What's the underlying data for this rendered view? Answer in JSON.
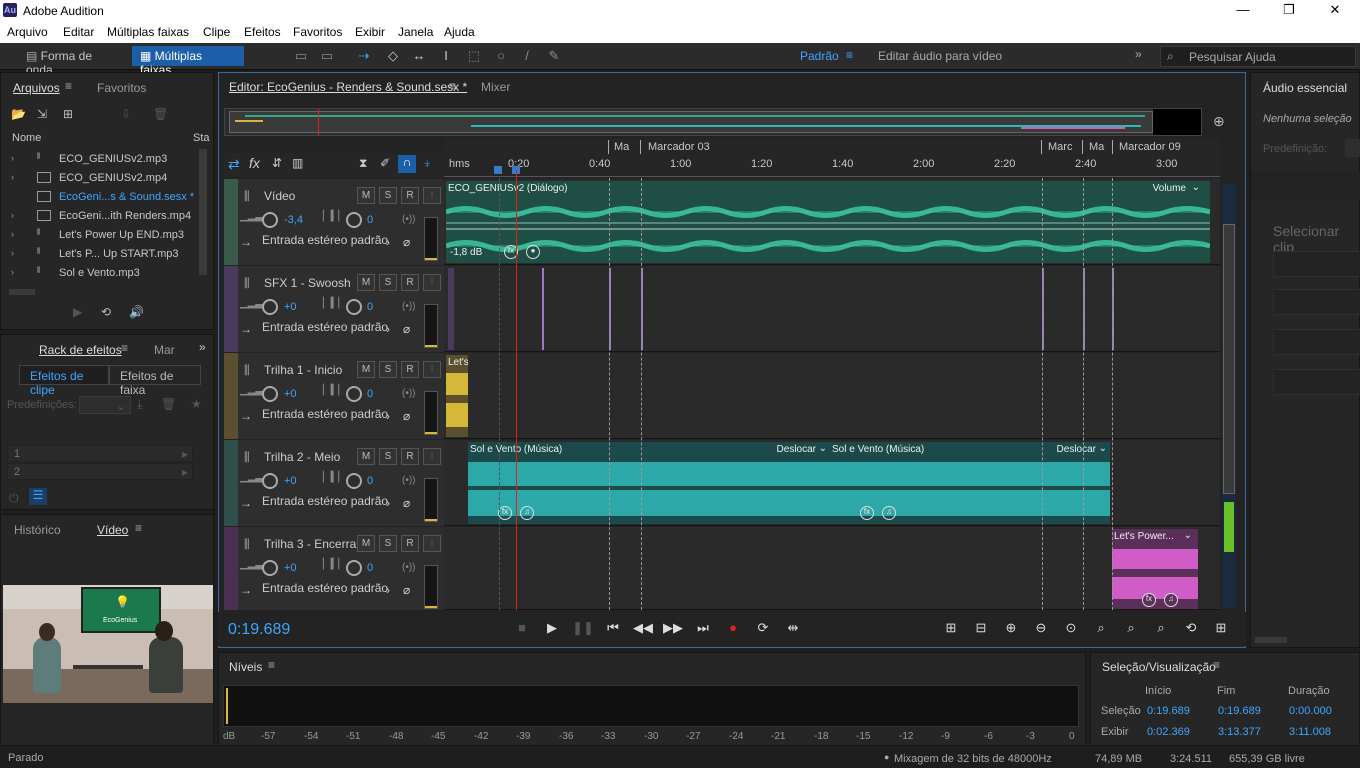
{
  "titlebar": {
    "logo": "Au",
    "title": "Adobe Audition",
    "min": "—",
    "max": "❐",
    "close": "✕"
  },
  "menu": [
    "Arquivo",
    "Editar",
    "Múltiplas faixas",
    "Clipe",
    "Efeitos",
    "Favoritos",
    "Exibir",
    "Janela",
    "Ajuda"
  ],
  "toolbar": {
    "waveform_label": "Forma de onda",
    "multitrack_label": "Múltiplas faixas",
    "workspace_default": "Padrão",
    "workspace_video": "Editar áudio para vídeo",
    "search_placeholder": "Pesquisar Ajuda"
  },
  "files_panel": {
    "tab_files": "Arquivos",
    "tab_favorites": "Favoritos",
    "col_name": "Nome",
    "col_status": "Sta",
    "files": [
      {
        "name": "ECO_GENIUSv2.mp3"
      },
      {
        "name": "ECO_GENIUSv2.mp4"
      },
      {
        "name": "EcoGeni...s & Sound.sesx *"
      },
      {
        "name": "EcoGeni...ith Renders.mp4"
      },
      {
        "name": "Let's Power Up END.mp3"
      },
      {
        "name": "Let's P... Up START.mp3"
      },
      {
        "name": "Sol e Vento.mp3"
      }
    ]
  },
  "effects_panel": {
    "title": "Rack de efeitos",
    "tab_markers": "Mar",
    "clip_effects": "Efeitos de clipe",
    "track_effects": "Efeitos de faixa",
    "presets_label": "Predefinições:",
    "slot1": "1",
    "slot2": "2"
  },
  "video_panel": {
    "tab_history": "Histórico",
    "tab_video": "Vídeo",
    "screen_text": "EcoGenius"
  },
  "editor": {
    "tab_title": "Editor: EcoGenius - Renders & Sound.sesx *",
    "tab_mixer": "Mixer",
    "markers": [
      "Ma",
      "Marcador 03",
      "Marc",
      "Ma",
      "Marcador 09"
    ],
    "ruler_unit": "hms",
    "ruler_labels": [
      "0:20",
      "0:40",
      "1:00",
      "1:20",
      "1:40",
      "2:00",
      "2:20",
      "2:40",
      "3:00"
    ],
    "current_time": "0:19.689"
  },
  "tracks": [
    {
      "name": "Vídeo",
      "vol": "-3,4",
      "pan": "0",
      "input": "Entrada estéreo padrão",
      "color": "#3a5a4a"
    },
    {
      "name": "SFX 1 - Swoosh",
      "vol": "+0",
      "pan": "0",
      "input": "Entrada estéreo padrão",
      "color": "#4a3a5e"
    },
    {
      "name": "Trilha 1 - Inicio",
      "vol": "+0",
      "pan": "0",
      "input": "Entrada estéreo padrão",
      "color": "#5a5030"
    },
    {
      "name": "Trilha 2 - Meio",
      "vol": "+0",
      "pan": "0",
      "input": "Entrada estéreo padrão",
      "color": "#2f4f4a"
    },
    {
      "name": "Trilha 3 - Encerra",
      "vol": "+0",
      "pan": "0",
      "input": "Entrada estéreo padrão",
      "color": "#4a2f50"
    }
  ],
  "track_buttons": {
    "m": "M",
    "s": "S",
    "r": "R",
    "i": "I"
  },
  "clips": {
    "video_clip": "ECO_GENIUSv2 (Diálogo)",
    "video_vol": "Volume",
    "video_db": "-1,8 dB",
    "trilha1_clip": "Let's...",
    "trilha2_clip_a": "Sol e Vento (Música)",
    "trilha2_clip_b": "Sol e Vento (Música)",
    "shift_label": "Deslocar",
    "trilha3_clip": "Let's Power..."
  },
  "levels_panel": {
    "title": "Níveis",
    "scale": [
      "dB",
      "-57",
      "-54",
      "-51",
      "-48",
      "-45",
      "-42",
      "-39",
      "-36",
      "-33",
      "-30",
      "-27",
      "-24",
      "-21",
      "-18",
      "-15",
      "-12",
      "-9",
      "-6",
      "-3",
      "0"
    ]
  },
  "selection_panel": {
    "title": "Seleção/Visualização",
    "col_start": "Início",
    "col_end": "Fim",
    "col_duration": "Duração",
    "row_sel": "Seleção",
    "sel_start": "0:19.689",
    "sel_end": "0:19.689",
    "sel_dur": "0:00.000",
    "row_view": "Exibir",
    "view_start": "0:02.369",
    "view_end": "3:13.377",
    "view_dur": "3:11.008"
  },
  "essential_panel": {
    "title": "Áudio essencial",
    "no_selection": "Nenhuma seleção",
    "preset_label": "Predefinição:",
    "select_clip": "Selecionar clip"
  },
  "status": {
    "state": "Parado",
    "mix": "Mixagem de 32 bits de 48000Hz",
    "size": "74,89 MB",
    "duration": "3:24.511",
    "free": "655,39 GB livre"
  },
  "colors": {
    "accent": "#3ea6ff",
    "video_wave": "#2fa58a",
    "music_wave": "#2fb8b8",
    "sfx_wave": "#9b7cc0",
    "yellow_clip": "#d6b838",
    "pink_clip": "#d05cc8",
    "playhead": "#e02020",
    "record": "#e02020"
  }
}
